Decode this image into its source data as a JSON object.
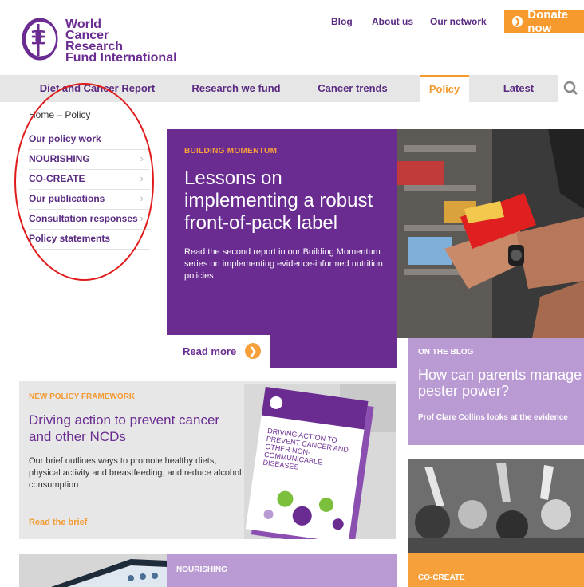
{
  "header": {
    "logo_lines": [
      "World",
      "Cancer",
      "Research",
      "Fund International"
    ],
    "top_links": [
      {
        "label": "Blog"
      },
      {
        "label": "About us"
      },
      {
        "label": "Our network"
      }
    ],
    "donate_label": "Donate now"
  },
  "nav": {
    "items": [
      {
        "label": "Diet and Cancer Report"
      },
      {
        "label": "Research we fund"
      },
      {
        "label": "Cancer trends"
      },
      {
        "label": "Policy"
      },
      {
        "label": "Latest"
      }
    ],
    "active": "Policy"
  },
  "breadcrumb": {
    "home": "Home",
    "separator": "–",
    "current": "Policy"
  },
  "side_menu": {
    "items": [
      {
        "label": "Our policy work"
      },
      {
        "label": "NOURISHING"
      },
      {
        "label": "CO-CREATE"
      },
      {
        "label": "Our publications"
      },
      {
        "label": "Consultation responses"
      },
      {
        "label": "Policy statements"
      }
    ]
  },
  "feature": {
    "kicker": "BUILDING MOMENTUM",
    "title": "Lessons on implementing a robust front-of-pack label",
    "description": "Read the second report in our Building Momentum series on implementing evidence-informed nutrition policies",
    "cta": "Read more"
  },
  "blog_card": {
    "kicker": "ON THE BLOG",
    "title": "How can parents manage pester power?",
    "description": "Prof Clare Collins looks at the evidence"
  },
  "policy_framework": {
    "kicker": "NEW POLICY FRAMEWORK",
    "title": "Driving action to prevent cancer and other NCDs",
    "description": "Our brief outlines ways to promote healthy diets, physical activity and breastfeeding, and reduce alcohol consumption",
    "cta": "Read the brief",
    "cover_title": "DRIVING ACTION TO PREVENT CANCER AND OTHER NON-COMMUNICABLE DISEASES"
  },
  "nourishing_card": {
    "kicker": "NOURISHING"
  },
  "cocreate_card": {
    "kicker": "CO-CREATE"
  },
  "colors": {
    "brand_purple": "#6a2c91",
    "accent_orange": "#f5a03b",
    "light_purple": "#b99ad3",
    "annotation_red": "#e01b1b"
  }
}
